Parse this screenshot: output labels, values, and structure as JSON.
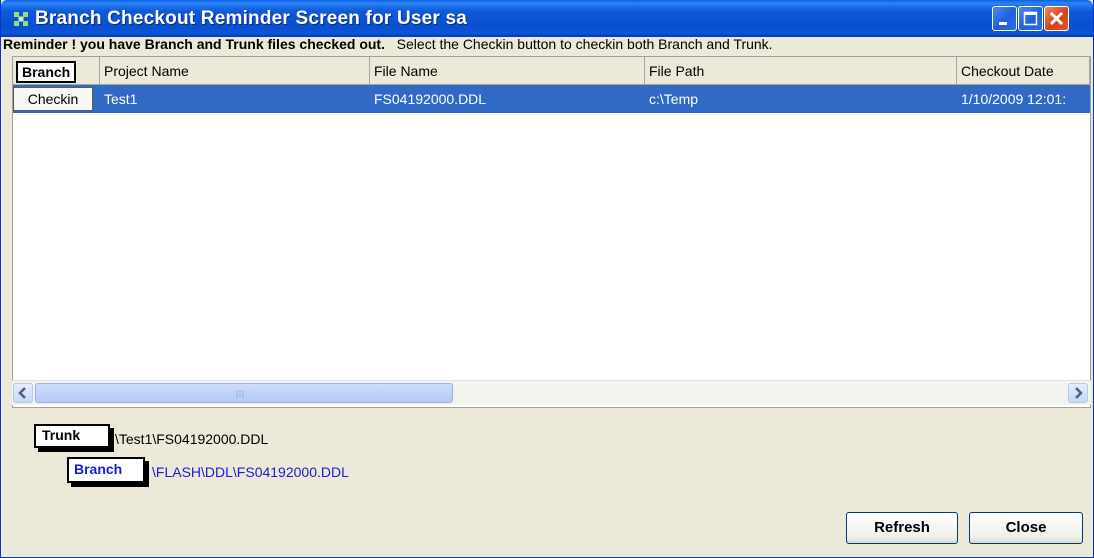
{
  "window": {
    "title": "Branch Checkout Reminder Screen for User sa"
  },
  "message": {
    "bold": "Reminder ! you have Branch and Trunk files checked out.",
    "normal": "Select the Checkin button to checkin both Branch and Trunk."
  },
  "table": {
    "header_button": "Branch",
    "columns": [
      "Project Name",
      "File Name",
      "File Path",
      "Checkout Date"
    ],
    "rows": [
      {
        "button": "Checkin",
        "project_name": "Test1",
        "file_name": "FS04192000.DDL",
        "file_path": "c:\\Temp",
        "checkout_date": "1/10/2009 12:01:"
      }
    ]
  },
  "trunk": {
    "label": "Trunk",
    "path": "\\Test1\\FS04192000.DDL"
  },
  "branch": {
    "label": "Branch",
    "path": "\\FLASH\\DDL\\FS04192000.DDL",
    "path_color": "#1a1ad6"
  },
  "buttons": {
    "refresh": "Refresh",
    "close": "Close"
  },
  "colors": {
    "selection": "#316ac5",
    "titlebar": "#0a56d6"
  }
}
